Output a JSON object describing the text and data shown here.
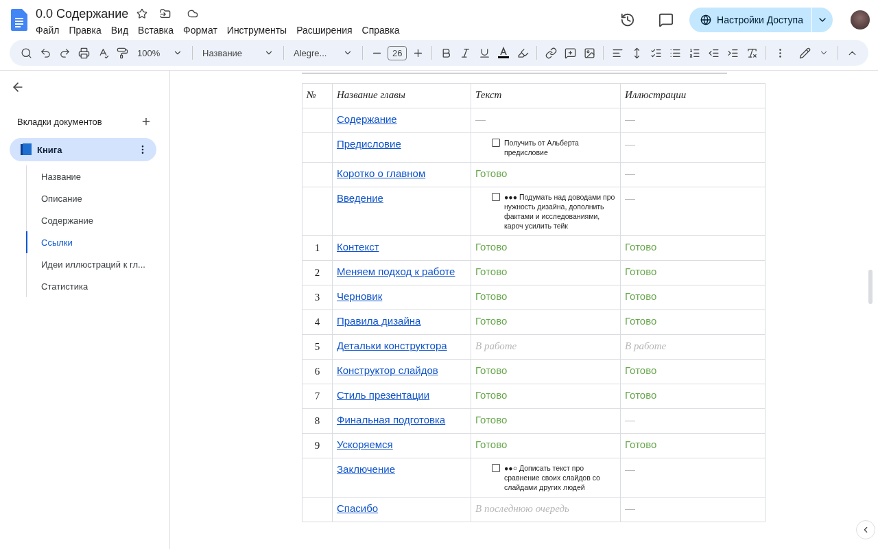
{
  "document": {
    "title": "0.0 Содержание",
    "starred": false
  },
  "menu": [
    "Файл",
    "Правка",
    "Вид",
    "Вставка",
    "Формат",
    "Инструменты",
    "Расширения",
    "Справка"
  ],
  "share_button": {
    "label": "Настройки Доступа"
  },
  "toolbar": {
    "zoom": "100%",
    "style": "Название",
    "font": "Alegre...",
    "size": "26"
  },
  "sidebar": {
    "heading": "Вкладки документов",
    "tab": {
      "label": "Книга",
      "selected": true,
      "expanded": true
    },
    "headings": [
      {
        "label": "Название",
        "selected": false
      },
      {
        "label": "Описание",
        "selected": false
      },
      {
        "label": "Содержание",
        "selected": false
      },
      {
        "label": "Ссылки",
        "selected": true
      },
      {
        "label": "Идеи иллюстраций к гл...",
        "selected": false
      },
      {
        "label": "Статистика",
        "selected": false
      }
    ]
  },
  "table": {
    "columns": [
      "№",
      "Название главы",
      "Текст",
      "Иллюстрации"
    ],
    "rows": [
      {
        "number": "",
        "title": "Содержание",
        "text": {
          "kind": "dash",
          "value": "—"
        },
        "illustrations": {
          "kind": "dash",
          "value": "—"
        }
      },
      {
        "number": "",
        "title": "Предисловие",
        "text": {
          "kind": "task",
          "value": "Получить от Альберта предисловие",
          "checked": false
        },
        "illustrations": {
          "kind": "dash",
          "value": "—"
        }
      },
      {
        "number": "",
        "title": "Коротко о главном",
        "text": {
          "kind": "done",
          "value": "Готово"
        },
        "illustrations": {
          "kind": "dash",
          "value": "—"
        }
      },
      {
        "number": "",
        "title": "Введение",
        "text": {
          "kind": "task",
          "value": "●●● Подумать над доводами про нужность дизайна, дополнить фактами и исследованиями, кароч усилить тейк",
          "checked": false
        },
        "illustrations": {
          "kind": "dash",
          "value": "—"
        }
      },
      {
        "number": "1",
        "title": "Контекст",
        "text": {
          "kind": "done",
          "value": "Готово"
        },
        "illustrations": {
          "kind": "done",
          "value": "Готово"
        }
      },
      {
        "number": "2",
        "title": "Меняем подход к работе",
        "text": {
          "kind": "done",
          "value": "Готово"
        },
        "illustrations": {
          "kind": "done",
          "value": "Готово"
        }
      },
      {
        "number": "3",
        "title": "Черновик",
        "text": {
          "kind": "done",
          "value": "Готово"
        },
        "illustrations": {
          "kind": "done",
          "value": "Готово"
        }
      },
      {
        "number": "4",
        "title": "Правила дизайна",
        "text": {
          "kind": "done",
          "value": "Готово"
        },
        "illustrations": {
          "kind": "done",
          "value": "Готово"
        }
      },
      {
        "number": "5",
        "title": "Детальки конструктора",
        "text": {
          "kind": "pending",
          "value": "В работе"
        },
        "illustrations": {
          "kind": "pending",
          "value": "В работе"
        }
      },
      {
        "number": "6",
        "title": "Конструктор слайдов",
        "text": {
          "kind": "done",
          "value": "Готово"
        },
        "illustrations": {
          "kind": "done",
          "value": "Готово"
        }
      },
      {
        "number": "7",
        "title": "Стиль презентации",
        "text": {
          "kind": "done",
          "value": "Готово"
        },
        "illustrations": {
          "kind": "done",
          "value": "Готово"
        }
      },
      {
        "number": "8",
        "title": "Финальная подготовка",
        "text": {
          "kind": "done",
          "value": "Готово"
        },
        "illustrations": {
          "kind": "dash",
          "value": "—"
        }
      },
      {
        "number": "9",
        "title": "Ускоряемся",
        "text": {
          "kind": "done",
          "value": "Готово"
        },
        "illustrations": {
          "kind": "done",
          "value": "Готово"
        }
      },
      {
        "number": "",
        "title": "Заключение",
        "text": {
          "kind": "task",
          "value": "●●○ Дописать текст про сравнение своих слайдов со слайдами других людей",
          "checked": false
        },
        "illustrations": {
          "kind": "dash",
          "value": "—"
        }
      },
      {
        "number": "",
        "title": "Спасибо",
        "text": {
          "kind": "pending",
          "value": "В последнюю очередь"
        },
        "illustrations": {
          "kind": "dash",
          "value": "—"
        }
      }
    ]
  }
}
